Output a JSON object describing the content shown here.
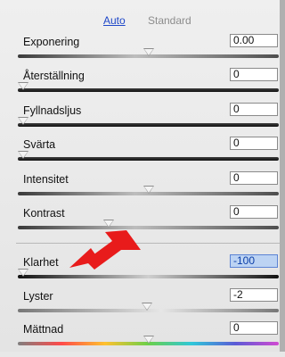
{
  "tabs": {
    "auto": "Auto",
    "standard": "Standard"
  },
  "sliders": [
    {
      "id": "exponering",
      "label": "Exponering",
      "value": "0.00",
      "position": 0.5,
      "track": "gray"
    },
    {
      "id": "aterstallning",
      "label": "Återställning",
      "value": "0",
      "position": 0.0,
      "track": "dark"
    },
    {
      "id": "fyllnadsljus",
      "label": "Fyllnadsljus",
      "value": "0",
      "position": 0.0,
      "track": "dark"
    },
    {
      "id": "svarta",
      "label": "Svärta",
      "value": "0",
      "position": 0.0,
      "track": "dark"
    },
    {
      "id": "intensitet",
      "label": "Intensitet",
      "value": "0",
      "position": 0.5,
      "track": "gray"
    },
    {
      "id": "kontrast",
      "label": "Kontrast",
      "value": "0",
      "position": 0.35,
      "track": "gray"
    }
  ],
  "presence": [
    {
      "id": "klarhet",
      "label": "Klarhet",
      "value": "-100",
      "position": 0.0,
      "track": "klar",
      "selected": true
    },
    {
      "id": "lyster",
      "label": "Lyster",
      "value": "-2",
      "position": 0.49,
      "track": "lyster"
    },
    {
      "id": "mattnad",
      "label": "Mättnad",
      "value": "0",
      "position": 0.5,
      "track": "rainbow"
    }
  ],
  "annotation": {
    "arrow_color": "#e81b1b"
  }
}
